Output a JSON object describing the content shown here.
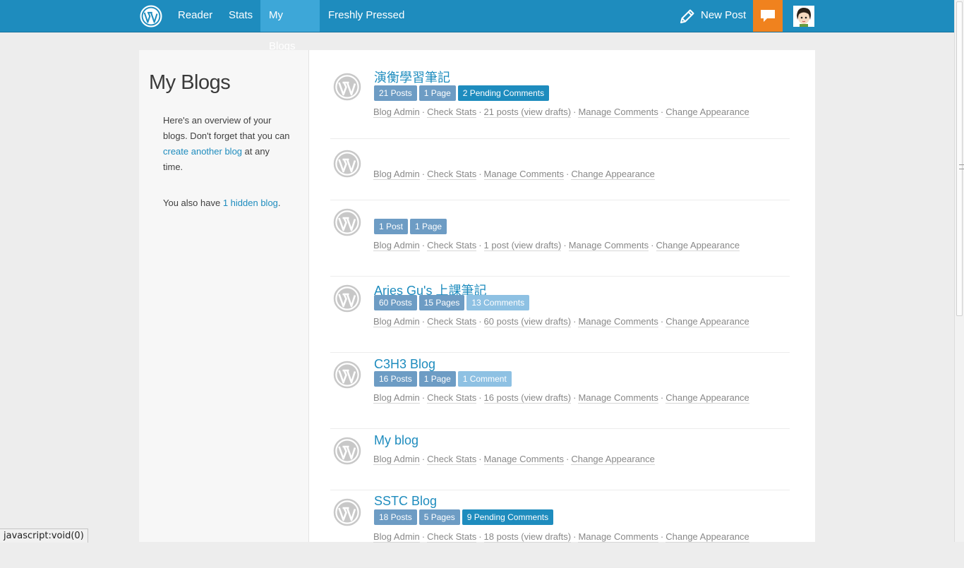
{
  "nav": {
    "items": [
      "Reader",
      "Stats",
      "My Blogs",
      "Freshly Pressed"
    ],
    "new_post": "New Post",
    "logo_icon": "wordpress-logo-icon",
    "new_post_icon": "pencil-icon",
    "notifications_icon": "speech-bubble-icon",
    "colors": {
      "bar": "#1e8cbe",
      "active": "#3da7d8",
      "notifications": "#f0821e"
    }
  },
  "sidebar": {
    "title": "My Blogs",
    "intro_before": "Here's an overview of your blogs. Don't forget that you can ",
    "intro_link": "create another blog",
    "intro_after": " at any time.",
    "hidden_before": "You also have ",
    "hidden_count": "1",
    "hidden_link": "hidden blog",
    "hidden_after": "."
  },
  "blogs": [
    {
      "title": "演衡學習筆記",
      "badges": [
        {
          "label": "21 Posts",
          "style": "mid"
        },
        {
          "label": "1 Page",
          "style": "mid"
        },
        {
          "label": "2 Pending Comments",
          "style": "dark"
        }
      ],
      "links": [
        "Blog Admin",
        "Check Stats",
        "21 posts (view drafts)",
        "Manage Comments",
        "Change Appearance"
      ]
    },
    {
      "title": "",
      "badges": [],
      "links": [
        "Blog Admin",
        "Check Stats",
        "Manage Comments",
        "Change Appearance"
      ]
    },
    {
      "title": "",
      "badges": [
        {
          "label": "1 Post",
          "style": "mid"
        },
        {
          "label": "1 Page",
          "style": "mid"
        }
      ],
      "links": [
        "Blog Admin",
        "Check Stats",
        "1 post (view drafts)",
        "Manage Comments",
        "Change Appearance"
      ]
    },
    {
      "title": "Aries Gu's 上課筆記",
      "badges": [
        {
          "label": "60 Posts",
          "style": "mid"
        },
        {
          "label": "15 Pages",
          "style": "mid"
        },
        {
          "label": "13 Comments",
          "style": "light"
        }
      ],
      "links": [
        "Blog Admin",
        "Check Stats",
        "60 posts (view drafts)",
        "Manage Comments",
        "Change Appearance"
      ]
    },
    {
      "title": "C3H3 Blog",
      "badges": [
        {
          "label": "16 Posts",
          "style": "mid"
        },
        {
          "label": "1 Page",
          "style": "mid"
        },
        {
          "label": "1 Comment",
          "style": "light"
        }
      ],
      "links": [
        "Blog Admin",
        "Check Stats",
        "16 posts (view drafts)",
        "Manage Comments",
        "Change Appearance"
      ]
    },
    {
      "title": "My blog",
      "badges": [],
      "links": [
        "Blog Admin",
        "Check Stats",
        "Manage Comments",
        "Change Appearance"
      ]
    },
    {
      "title": "SSTC Blog",
      "badges": [
        {
          "label": "18 Posts",
          "style": "mid"
        },
        {
          "label": "5 Pages",
          "style": "mid"
        },
        {
          "label": "9 Pending Comments",
          "style": "dark"
        }
      ],
      "links": [
        "Blog Admin",
        "Check Stats",
        "18 posts (view drafts)",
        "Manage Comments",
        "Change Appearance"
      ]
    }
  ],
  "link_separator": "·",
  "status_bar": "javascript:void(0)"
}
